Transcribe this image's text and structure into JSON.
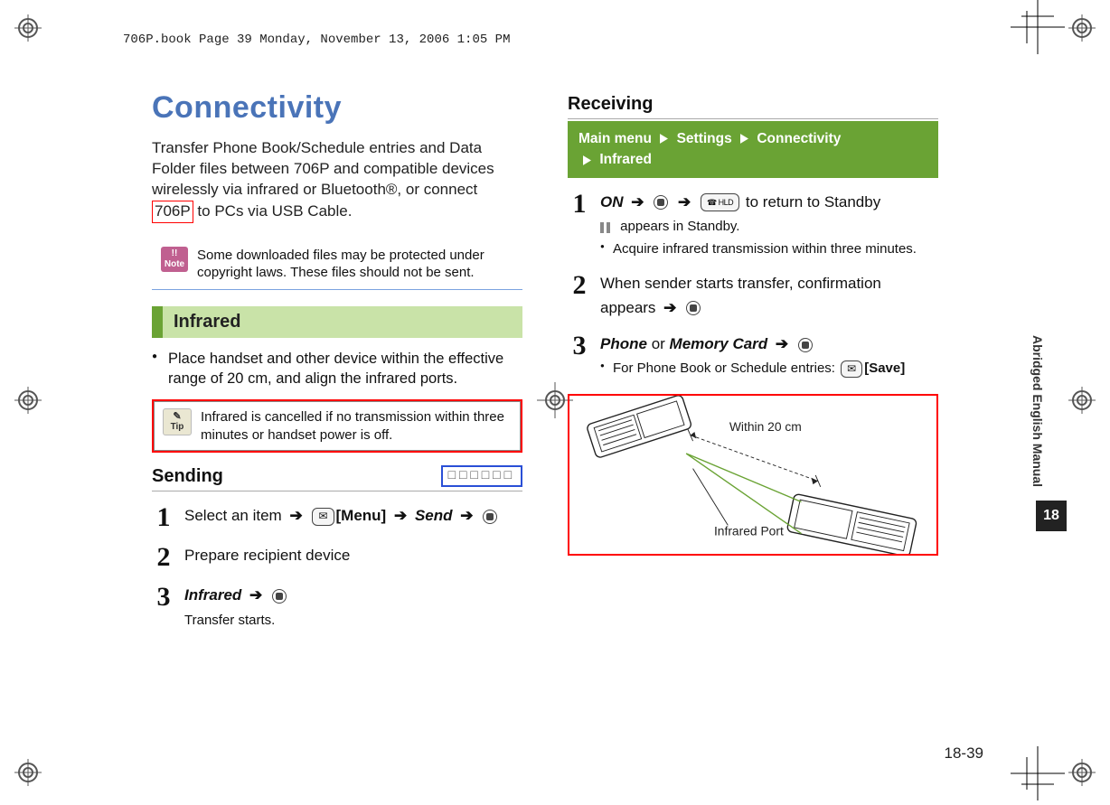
{
  "header": {
    "stamp": "706P.book  Page 39  Monday, November 13, 2006  1:05 PM"
  },
  "title": "Connectivity",
  "intro_prefix": "Transfer Phone Book/Schedule entries and Data Folder files between 706P and compatible devices wirelessly via infrared or Bluetooth®, or connect ",
  "intro_model": "706P",
  "intro_suffix": " to PCs via USB Cable.",
  "note": {
    "badge": "Note",
    "text": "Some downloaded files may be protected under copyright laws. These files should not be sent."
  },
  "section_infrared": "Infrared",
  "infra_bullet": "Place handset and other device within the effective range of 20 cm, and align the infrared ports.",
  "tip": {
    "badge": "Tip",
    "text": "Infrared is cancelled if no transmission within three minutes or handset power is off."
  },
  "sending": {
    "heading": "Sending",
    "placeholder": "□□□□□□",
    "step1_a": "Select an item",
    "step1_b": "[Menu]",
    "step1_c": "Send",
    "step2": "Prepare recipient device",
    "step3_a": "Infrared",
    "step3_b": "Transfer starts."
  },
  "receiving": {
    "heading": "Receiving",
    "menu": {
      "a": "Main menu",
      "b": "Settings",
      "c": "Connectivity",
      "d": "Infrared"
    },
    "step1_a": "ON",
    "step1_b": " to return to Standby",
    "step1_c": " appears in Standby.",
    "step1_d": "Acquire infrared transmission within three minutes.",
    "step2": "When sender starts transfer, confirmation appears",
    "step3_a": "Phone",
    "step3_or": " or ",
    "step3_b": "Memory Card",
    "step3_c": "For Phone Book or Schedule entries: ",
    "step3_d": "[Save]"
  },
  "diagram": {
    "within": "Within 20 cm",
    "port": "Infrared Port"
  },
  "side": {
    "label": "Abridged English Manual",
    "chapter": "18"
  },
  "page_number": "18-39",
  "chart_data": null
}
